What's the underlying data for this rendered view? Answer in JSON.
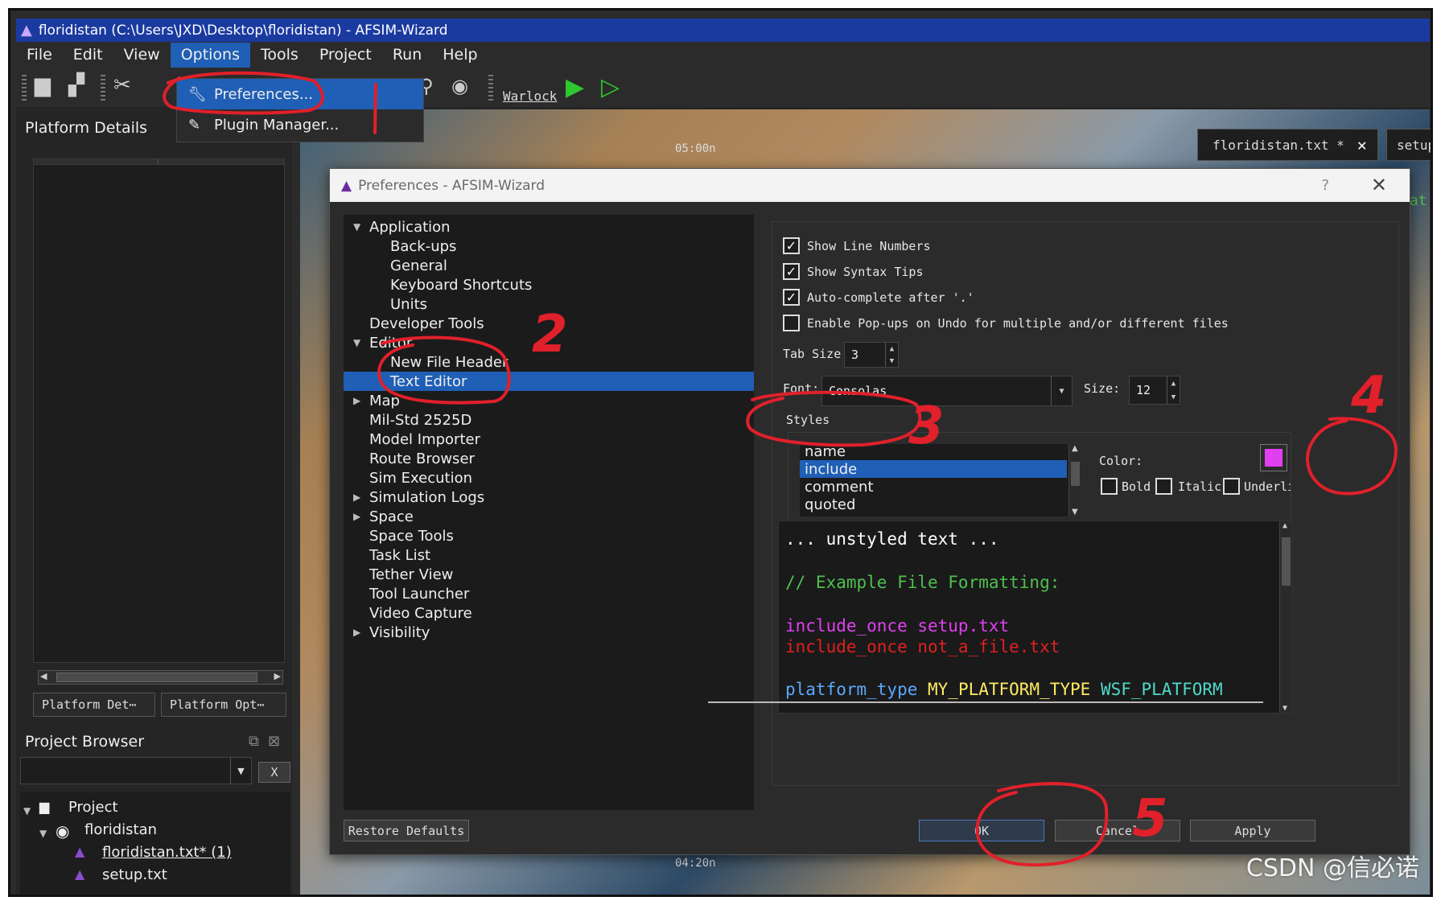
{
  "window": {
    "title": "floridistan (C:\\Users\\JXD\\Desktop\\floridistan) - AFSIM-Wizard"
  },
  "menubar": {
    "items": [
      "File",
      "Edit",
      "View",
      "Options",
      "Tools",
      "Project",
      "Run",
      "Help"
    ],
    "active": "Options"
  },
  "options_menu": {
    "items": [
      {
        "label": "Preferences...",
        "icon": "wrench-icon"
      },
      {
        "label": "Plugin Manager...",
        "icon": "plugin-icon"
      }
    ]
  },
  "toolbar": {
    "warlock_label": "Warlock",
    "icons": [
      "save-icon",
      "save-all-icon",
      "scissors-icon",
      "search-icon",
      "eye-icon",
      "run-icon",
      "run-outline-icon"
    ]
  },
  "left_dock": {
    "platform_details_title": "Platform Details",
    "tabs": [
      "Platform Det⋯",
      "Platform Opt⋯"
    ],
    "project_browser_title": "Project Browser",
    "clear_button": "X",
    "tree": {
      "root": "Project",
      "project": "floridistan",
      "files": [
        "floridistan.txt* (1)",
        "setup.txt"
      ]
    }
  },
  "editor_tabs": [
    {
      "label": "floridistan.txt *"
    },
    {
      "label": "setup"
    }
  ],
  "map": {
    "labels": [
      "05:00n",
      "04:20n",
      "rat"
    ]
  },
  "dialog": {
    "title": "Preferences - AFSIM-Wizard",
    "help_glyph": "?",
    "close_glyph": "✕",
    "nav": [
      {
        "label": "Application",
        "level": 0,
        "arrow": "down"
      },
      {
        "label": "Back-ups",
        "level": 1
      },
      {
        "label": "General",
        "level": 1
      },
      {
        "label": "Keyboard Shortcuts",
        "level": 1
      },
      {
        "label": "Units",
        "level": 1
      },
      {
        "label": "Developer Tools",
        "level": 0
      },
      {
        "label": "Editor",
        "level": 0,
        "arrow": "down"
      },
      {
        "label": "New File Header",
        "level": 1
      },
      {
        "label": "Text Editor",
        "level": 1,
        "selected": true
      },
      {
        "label": "Map",
        "level": 0,
        "arrow": "right"
      },
      {
        "label": "Mil-Std 2525D",
        "level": 0
      },
      {
        "label": "Model Importer",
        "level": 0
      },
      {
        "label": "Route Browser",
        "level": 0
      },
      {
        "label": "Sim Execution",
        "level": 0
      },
      {
        "label": "Simulation Logs",
        "level": 0,
        "arrow": "right"
      },
      {
        "label": "Space",
        "level": 0,
        "arrow": "right"
      },
      {
        "label": "Space Tools",
        "level": 0
      },
      {
        "label": "Task List",
        "level": 0
      },
      {
        "label": "Tether View",
        "level": 0
      },
      {
        "label": "Tool Launcher",
        "level": 0
      },
      {
        "label": "Video Capture",
        "level": 0
      },
      {
        "label": "Visibility",
        "level": 0,
        "arrow": "right"
      }
    ],
    "checkboxes": [
      {
        "label": "Show Line Numbers",
        "checked": true
      },
      {
        "label": "Show Syntax Tips",
        "checked": true
      },
      {
        "label": "Auto-complete after '.'",
        "checked": true
      },
      {
        "label": "Enable Pop-ups on Undo for multiple and/or different files",
        "checked": false
      }
    ],
    "tab_size_label": "Tab Size",
    "tab_size_value": "3",
    "font_label": "Font:",
    "font_value": "Consolas",
    "size_label": "Size:",
    "size_value": "12",
    "styles_label": "Styles",
    "styles": [
      {
        "label": "name"
      },
      {
        "label": "include",
        "selected": true
      },
      {
        "label": "comment"
      },
      {
        "label": "quoted"
      }
    ],
    "color_label": "Color:",
    "color_value": "#e040f0",
    "style_options": [
      "Bold",
      "Italic",
      "Underline"
    ],
    "preview": [
      {
        "text": "... unstyled text ...",
        "color": "#ffffff"
      },
      {
        "text": "// Example File Formatting:",
        "color": "#4fc04f"
      },
      {
        "text": "include_once setup.txt",
        "color": "#e040f0"
      },
      {
        "text": "include_once not_a_file.txt",
        "color": "#e02020"
      },
      {
        "segments": [
          {
            "text": "platform_type ",
            "color": "#5aa8ff"
          },
          {
            "text": "MY_PLATFORM_TYPE ",
            "color": "#ffea60"
          },
          {
            "text": "WSF_PLATFORM",
            "color": "#4fd8c8"
          }
        ]
      }
    ],
    "buttons": {
      "restore": "Restore Defaults",
      "ok": "OK",
      "cancel": "Cancel",
      "apply": "Apply"
    }
  },
  "annotations": [
    "2",
    "3",
    "4",
    "5"
  ],
  "watermark": "CSDN @信必诺",
  "colors": {
    "accent": "#1f5fb5",
    "titlebar": "#1a3aa0",
    "annotation_red": "#e0202a"
  }
}
